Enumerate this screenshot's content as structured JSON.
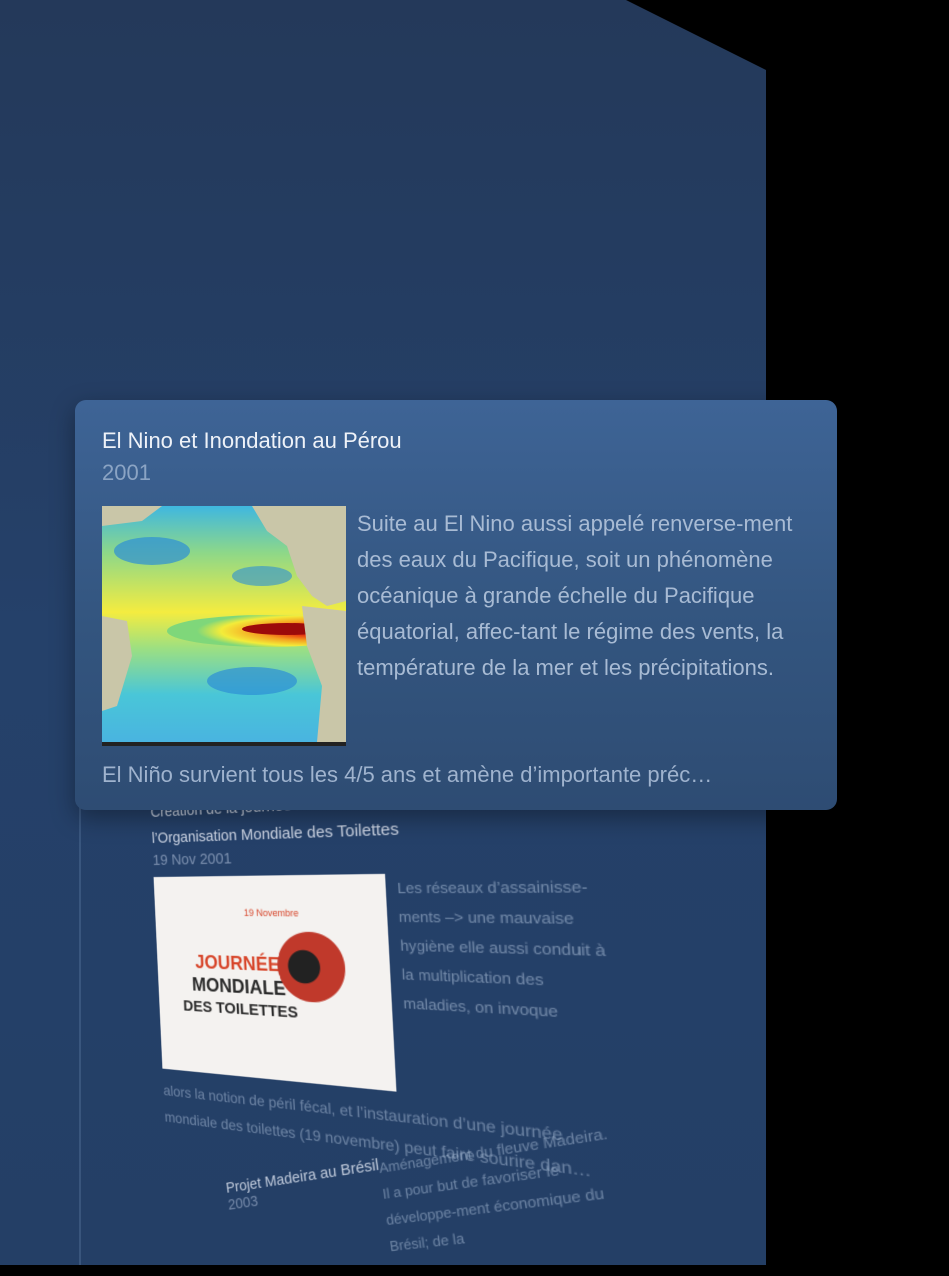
{
  "featured": {
    "title": "El Nino et Inondation au Pérou",
    "year": "2001",
    "image": "el-nino-sea-temperature-map",
    "description": "Suite au El Nino aussi appelé renverse-ment des eaux du Pacifique, soit un phénomène océanique à grande échelle du Pacifique équatorial, affec-tant le régime des vents, la température de la mer et les précipitations.",
    "excerpt": "El Niño survient tous les 4/5 ans et amène d’importante préc…"
  },
  "cards": [
    {
      "title_line1": "Création de la journée mondiale des toilettes et de",
      "title_line2": "l’Organisation Mondiale des Toilettes",
      "date": "19 Nov 2001",
      "thumb_tag": "19 Novembre",
      "thumb_line1": "JOURNÉE",
      "thumb_line2": "MONDIALE",
      "thumb_line3": "DES TOILETTES",
      "body": "Les réseaux d’assainisse-ments –> une mauvaise hygiène elle aussi conduit à la multiplication des maladies, on invoque",
      "foot": "alors la notion de péril fécal, et l’instauration d’une journée mondiale des toilettes (19 novembre) peut faire sourire dan…"
    },
    {
      "title": "Projet Madeira au Brésil",
      "date": "2003",
      "body": "Aménagement du fleuve Madeira. Il a pour but de favoriser le développe-ment économique du Brésil; de la"
    }
  ]
}
